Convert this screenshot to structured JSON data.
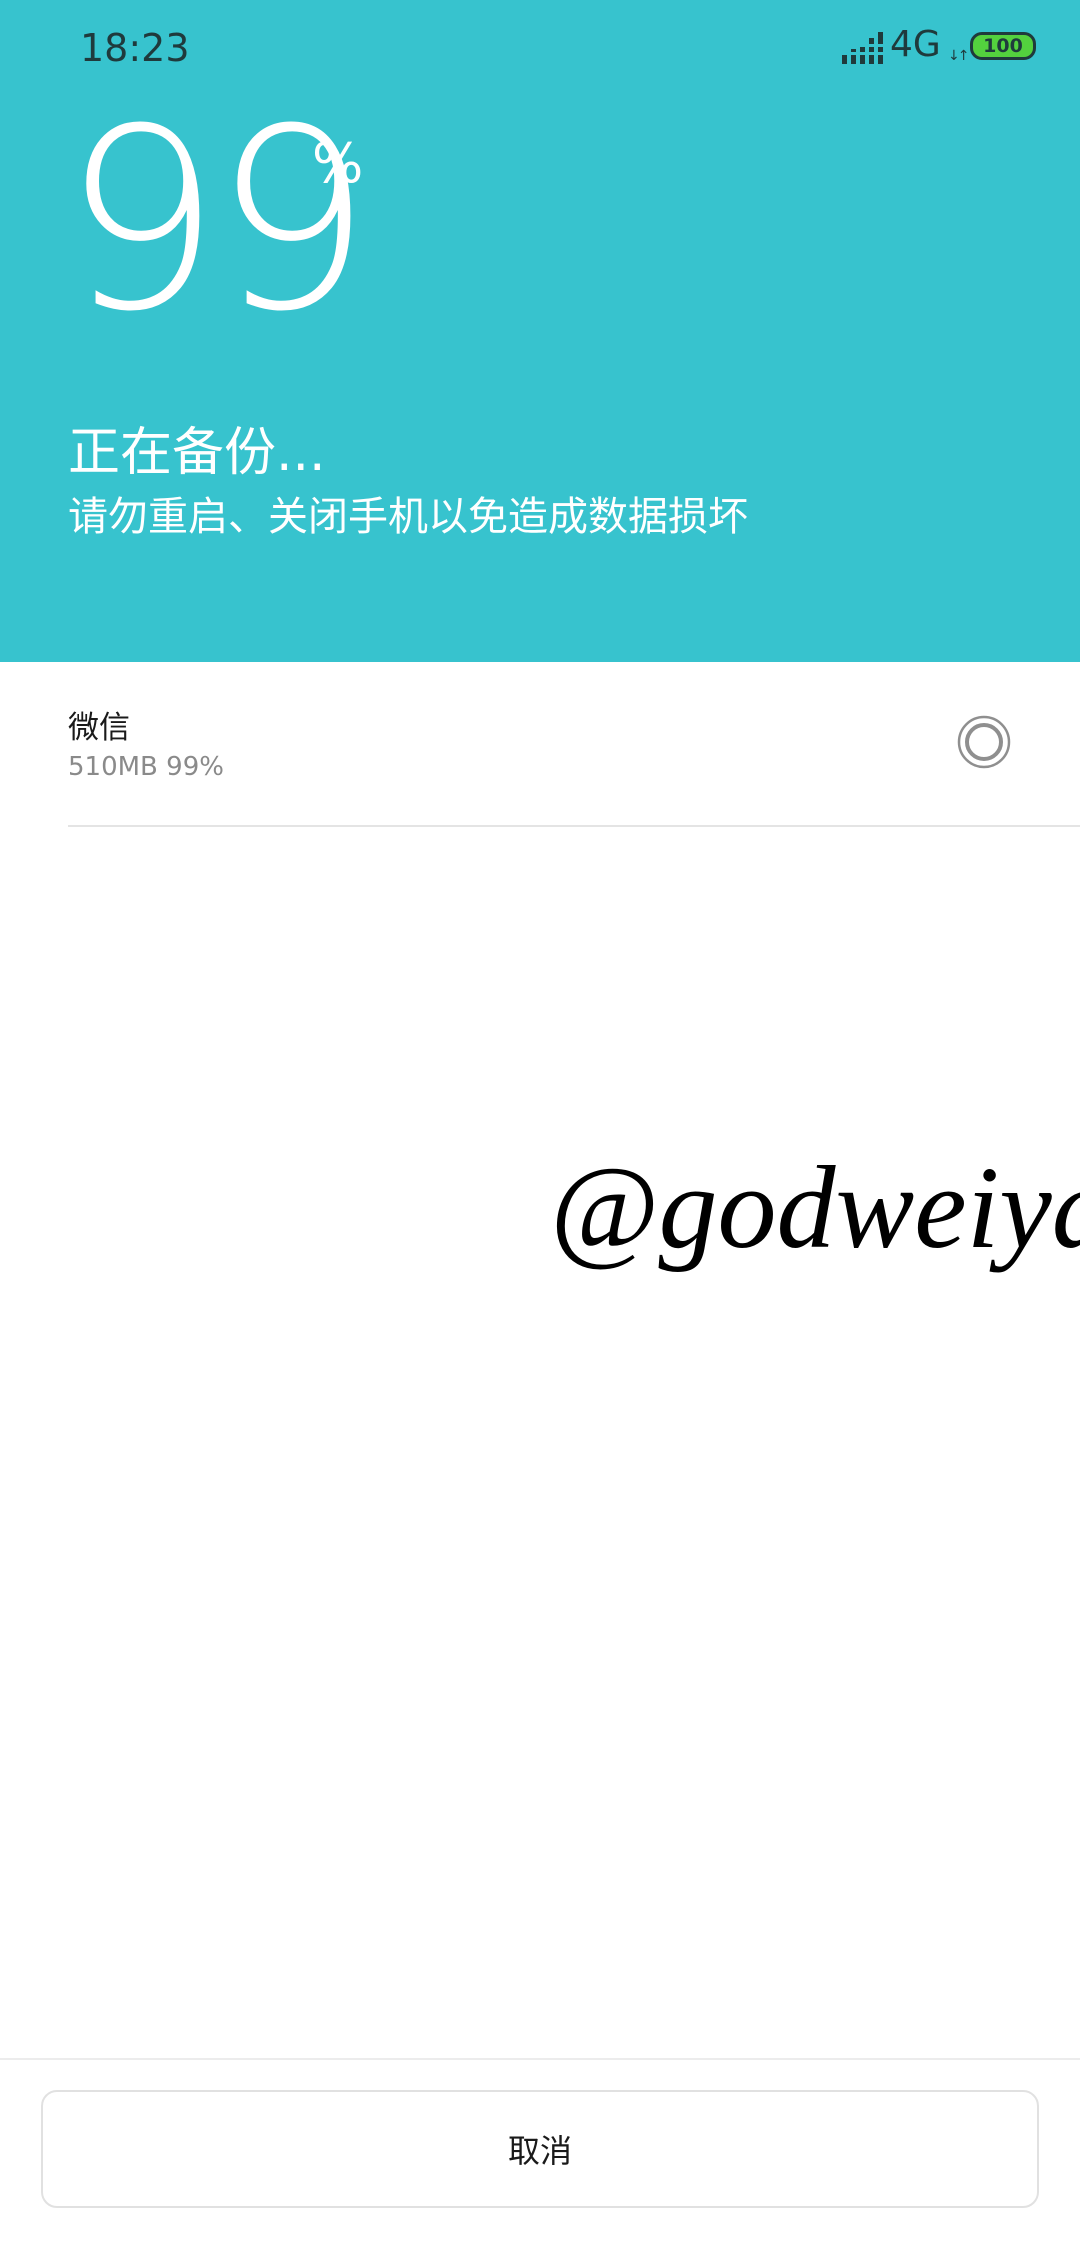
{
  "status_bar": {
    "time": "18:23",
    "network": "4G",
    "network_arrows": "↓↑",
    "battery": "100",
    "icons": [
      "signal-icon",
      "battery-icon"
    ]
  },
  "header": {
    "percent": "99",
    "percent_sign": "%",
    "title": "正在备份...",
    "warning": "请勿重启、关闭手机以免造成数据损坏",
    "background_color": "#37c3ce"
  },
  "backup_items": [
    {
      "name": "微信",
      "detail": "510MB 99%",
      "progress": 0.99,
      "status_icon": "progress-spinner-icon"
    }
  ],
  "watermark": "@godweiyang",
  "footer": {
    "cancel_label": "取消"
  }
}
